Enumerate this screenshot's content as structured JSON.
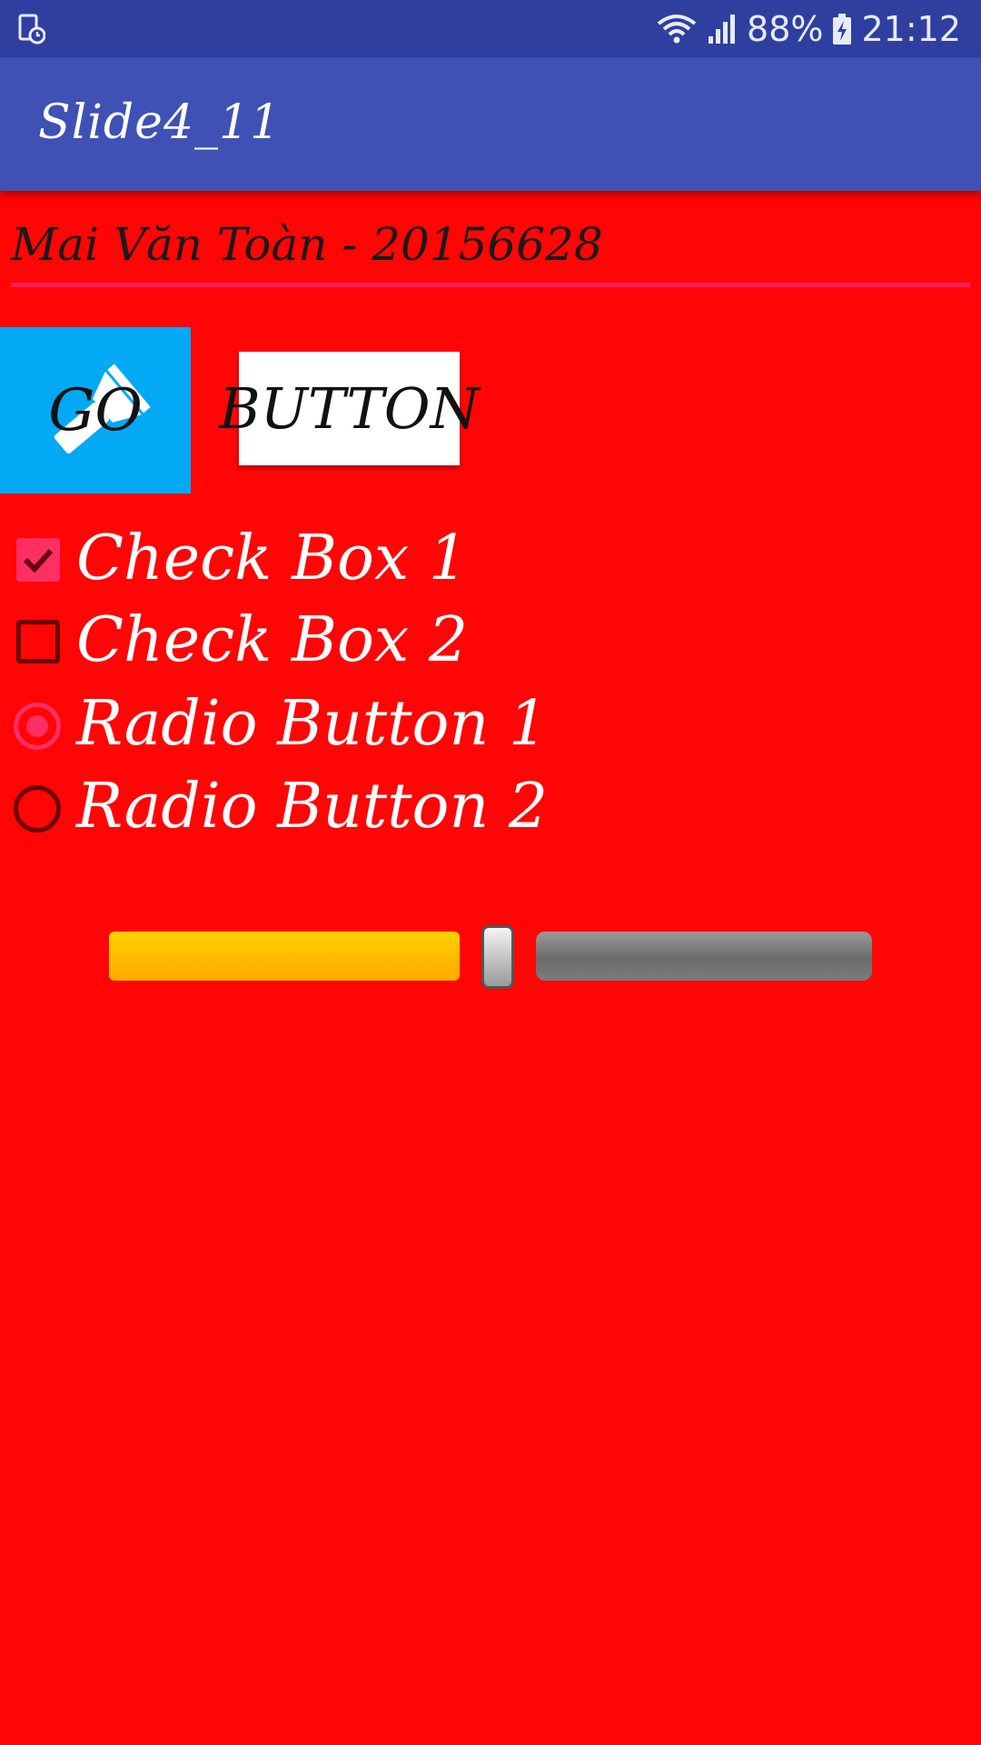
{
  "status_bar": {
    "battery": "88%",
    "time": "21:12",
    "icons": [
      "screen-record-icon",
      "wifi-icon",
      "signal-icon",
      "battery-charging-icon"
    ]
  },
  "app_bar": {
    "title": "Slide4_11",
    "color": "#3f51b5"
  },
  "form": {
    "name_value": "Mai Văn Toàn - 20156628",
    "go_button_label": "GO",
    "button_label": "BUTTON",
    "checkbox_1": {
      "label": "Check Box 1",
      "checked": true
    },
    "checkbox_2": {
      "label": "Check Box 2",
      "checked": false
    },
    "radio_1": {
      "label": "Radio Button 1",
      "checked": true
    },
    "radio_2": {
      "label": "Radio Button 2",
      "checked": false
    },
    "seekbar_progress": 0.48
  },
  "colors": {
    "background": "#ff0505",
    "accent": "#ff2f63",
    "go_button": "#03a9f4",
    "seek_progress": "#ffc400"
  }
}
